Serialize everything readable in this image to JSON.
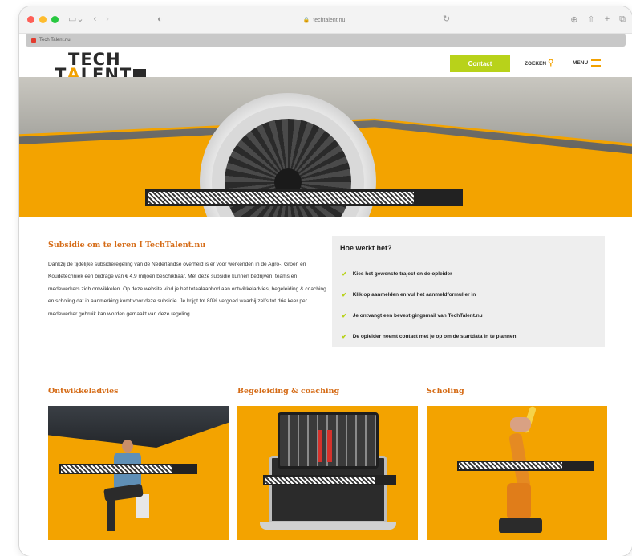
{
  "browser": {
    "url": "techtalent.nu",
    "tab_title": "Tech Talent.nu",
    "traffic_colors": [
      "#fe5f57",
      "#febc2e",
      "#28c840"
    ]
  },
  "header": {
    "logo_line1": "TECH",
    "logo_line2_pre": "T",
    "logo_line2_a": "A",
    "logo_line2_post": "LENT",
    "contact_label": "Contact",
    "search_label": "ZOEKEN",
    "menu_label": "MENU",
    "accent_color": "#f2a100",
    "button_color": "#b8d21a"
  },
  "hero": {
    "progress_fraction": 0.85
  },
  "intro": {
    "title": "Subsidie om te leren I TechTalent.nu",
    "text": "Dankzij de tijdelijke subsidieregeling van de Nederlandse overheid is er voor werkenden in de Agro-, Groen en Koudetechniek een bijdrage van € 4,9 miljoen beschikbaar. Met deze subsidie kunnen bedrijven, teams en medewerkers zich ontwikkelen. Op deze website vind je het totaalaanbod aan ontwikkeladvies, begeleiding & coaching en scholing dat in aanmerking komt voor deze subsidie. Je krijgt tot 80% vergoed waarbij zelfs tot drie keer per medewerker gebruik kan worden gemaakt van deze regeling."
  },
  "how": {
    "title": "Hoe werkt het?",
    "steps": [
      "Kies het gewenste traject en de opleider",
      "Klik op aanmelden en vul het aanmeldformulier in",
      "Je ontvangt een bevestigingsmail van TechTalent.nu",
      "De opleider neemt contact met je op om de startdata in te plannen"
    ]
  },
  "cards": [
    {
      "title": "Ontwikkeladvies",
      "progress_fraction": 0.82
    },
    {
      "title": "Begeleiding & coaching",
      "progress_fraction": 0.85
    },
    {
      "title": "Scholing",
      "progress_fraction": 0.78
    }
  ]
}
